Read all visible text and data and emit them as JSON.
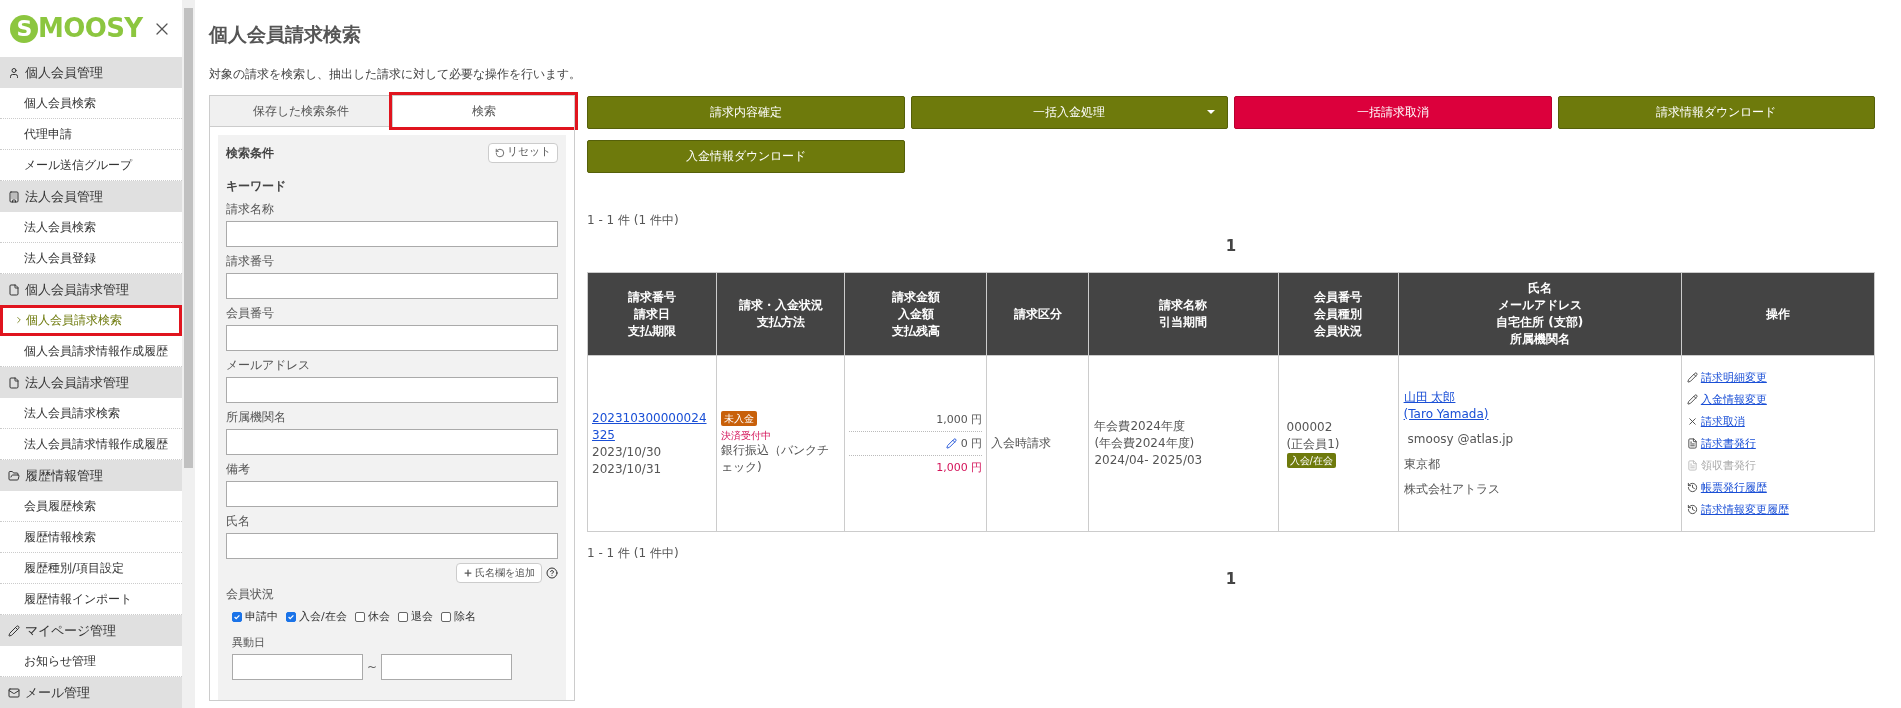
{
  "logo": {
    "text": "SMOOSY"
  },
  "sidebar": {
    "sections": [
      {
        "label": "個人会員管理",
        "kind": "person",
        "items": [
          {
            "label": "個人会員検索",
            "selected": false,
            "highlighted": false
          },
          {
            "label": "代理申請",
            "selected": false,
            "highlighted": false
          },
          {
            "label": "メール送信グループ",
            "selected": false,
            "highlighted": false
          }
        ]
      },
      {
        "label": "法人会員管理",
        "kind": "building",
        "items": [
          {
            "label": "法人会員検索",
            "selected": false,
            "highlighted": false
          },
          {
            "label": "法人会員登録",
            "selected": false,
            "highlighted": false
          }
        ]
      },
      {
        "label": "個人会員請求管理",
        "kind": "file",
        "items": [
          {
            "label": "個人会員請求検索",
            "selected": true,
            "highlighted": true
          },
          {
            "label": "個人会員請求情報作成履歴",
            "selected": false,
            "highlighted": false
          }
        ]
      },
      {
        "label": "法人会員請求管理",
        "kind": "file",
        "items": [
          {
            "label": "法人会員請求検索",
            "selected": false,
            "highlighted": false
          },
          {
            "label": "法人会員請求情報作成履歴",
            "selected": false,
            "highlighted": false
          }
        ]
      },
      {
        "label": "履歴情報管理",
        "kind": "folder",
        "items": [
          {
            "label": "会員履歴検索",
            "selected": false,
            "highlighted": false
          },
          {
            "label": "履歴情報検索",
            "selected": false,
            "highlighted": false
          },
          {
            "label": "履歴種別/項目設定",
            "selected": false,
            "highlighted": false
          },
          {
            "label": "履歴情報インポート",
            "selected": false,
            "highlighted": false
          }
        ]
      },
      {
        "label": "マイページ管理",
        "kind": "pencil",
        "items": [
          {
            "label": "お知らせ管理",
            "selected": false,
            "highlighted": false
          }
        ]
      },
      {
        "label": "メール管理",
        "kind": "mail"
      }
    ]
  },
  "page": {
    "title": "個人会員請求検索",
    "description": "対象の請求を検索し、抽出した請求に対して必要な操作を行います。"
  },
  "search_panel": {
    "tabs": [
      {
        "label": "保存した検索条件",
        "selected": false,
        "highlighted": false
      },
      {
        "label": "検索",
        "selected": true,
        "highlighted": true
      }
    ],
    "heading": "検索条件",
    "reset_button": "リセット",
    "keyword_label": "キーワード",
    "fields": [
      {
        "label": "請求名称"
      },
      {
        "label": "請求番号"
      },
      {
        "label": "会員番号"
      },
      {
        "label": "メールアドレス"
      },
      {
        "label": "所属機関名"
      },
      {
        "label": "備考"
      },
      {
        "label": "氏名"
      }
    ],
    "add_name_button": "氏名欄を追加",
    "status_label": "会員状況",
    "statuses": [
      {
        "label": "申請中",
        "checked": true
      },
      {
        "label": "入会/在会",
        "checked": true
      },
      {
        "label": "休会",
        "checked": false
      },
      {
        "label": "退会",
        "checked": false
      },
      {
        "label": "除名",
        "checked": false
      }
    ],
    "date_label": "異動日",
    "date_separator": "~"
  },
  "actions": [
    {
      "label": "請求内容確定",
      "kind": "primary",
      "dropdown": false
    },
    {
      "label": "一括入金処理",
      "kind": "primary",
      "dropdown": true
    },
    {
      "label": "一括請求取消",
      "kind": "danger",
      "dropdown": false
    },
    {
      "label": "請求情報ダウンロード",
      "kind": "primary",
      "dropdown": false
    },
    {
      "label": "入金情報ダウンロード",
      "kind": "primary",
      "dropdown": false
    }
  ],
  "pagination_top": {
    "summary": "1 - 1 件 (1 件中)",
    "page": "1"
  },
  "table": {
    "columns": [
      [
        "請求番号",
        "請求日",
        "支払期限"
      ],
      [
        "請求・入金状況",
        "支払方法"
      ],
      [
        "請求金額",
        "入金額",
        "支払残高"
      ],
      [
        "請求区分"
      ],
      [
        "請求名称",
        "引当期間"
      ],
      [
        "会員番号",
        "会員種別",
        "会員状況"
      ],
      [
        "氏名",
        "メールアドレス",
        "自宅住所 (支部)",
        "所属機関名"
      ],
      [
        "操作"
      ]
    ],
    "rows": [
      {
        "invoice_no": "202310300000024325",
        "invoice_date": "2023/10/30",
        "due_date": "2023/10/31",
        "status_badge": "未入金",
        "payment_note": "決済受付中",
        "payment_method": "銀行振込（バンクチェック)",
        "billed": "1,000 円",
        "paid": "0 円",
        "balance": "1,000 円",
        "category": "入会時請求",
        "name_lines": [
          "年会費2024年度",
          "(年会費2024年度)",
          "2024/04- 2025/03"
        ],
        "member_no": "000002",
        "member_type": "(正会員1)",
        "member_status": "入会/在会",
        "name": "山田 太郎",
        "name_en": "(Taro Yamada)",
        "email": "smoosy @atlas.jp",
        "address": "東京都",
        "organization": "株式会社アトラス",
        "operations": [
          {
            "label": "請求明細変更",
            "kind": "edit",
            "disabled": false
          },
          {
            "label": "入金情報変更",
            "kind": "edit",
            "disabled": false
          },
          {
            "label": "請求取消",
            "kind": "cancel",
            "disabled": false
          },
          {
            "label": "請求書発行",
            "kind": "document",
            "disabled": false
          },
          {
            "label": "領収書発行",
            "kind": "document",
            "disabled": true
          },
          {
            "label": "帳票発行履歴",
            "kind": "history",
            "disabled": false
          },
          {
            "label": "請求情報変更履歴",
            "kind": "history",
            "disabled": false
          }
        ]
      }
    ]
  },
  "pagination_bottom": {
    "summary": "1 - 1 件 (1 件中)",
    "page": "1"
  }
}
